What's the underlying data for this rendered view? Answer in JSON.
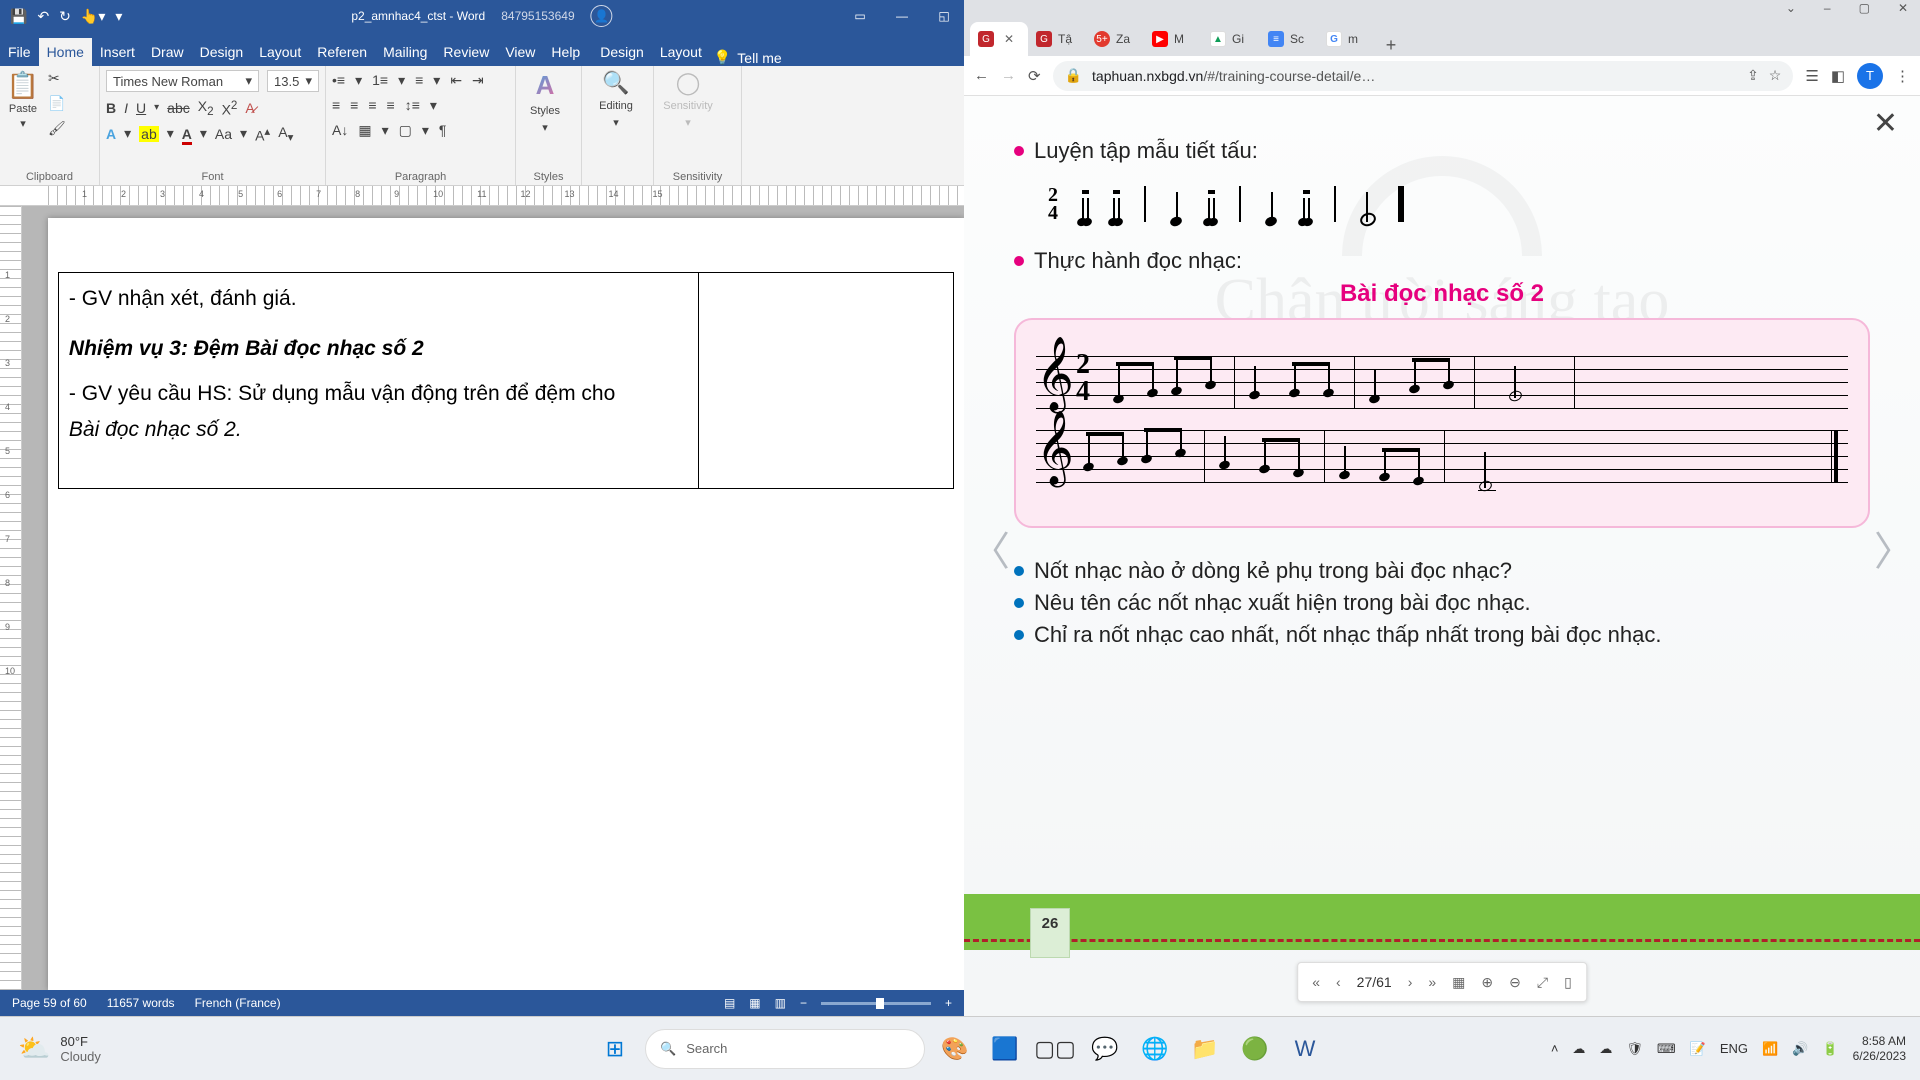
{
  "word": {
    "title_doc": "p2_amnhac4_ctst - Word",
    "title_user": "84795153649",
    "qat_icons": [
      "save-icon",
      "undo-icon",
      "redo-icon",
      "touch-icon",
      "dropdown-icon"
    ],
    "tabs": [
      "File",
      "Home",
      "Insert",
      "Draw",
      "Design",
      "Layout",
      "Referen",
      "Mailing",
      "Review",
      "View",
      "Help",
      "Design",
      "Layout"
    ],
    "active_tab": "Home",
    "tell_me": "Tell me",
    "ribbon": {
      "clipboard_label": "Clipboard",
      "paste_label": "Paste",
      "font_label": "Font",
      "font_name": "Times New Roman",
      "font_size": "13.5",
      "paragraph_label": "Paragraph",
      "styles_label": "Styles",
      "styles_big": "Styles",
      "editing_label": "Editing",
      "sensitivity_label": "Sensitivity"
    },
    "ruler_h": [
      " ",
      "1",
      "2",
      "3",
      "4",
      "5",
      "6",
      "7",
      "8",
      "9",
      "10",
      "11",
      "12",
      "13",
      "14",
      "15"
    ],
    "ruler_v": [
      "",
      "1",
      "2",
      "3",
      "4",
      "5",
      "6",
      "7",
      "8",
      "9",
      "10"
    ],
    "doc": {
      "line1": "- GV nhận xét, đánh giá.",
      "task_title": "Nhiệm vụ 3: Đệm Bài đọc nhạc số 2",
      "line2": "- GV yêu cầu HS: Sử dụng mẫu vận động trên để đệm cho",
      "line3": "Bài đọc nhạc số 2."
    },
    "status": {
      "page": "Page 59 of 60",
      "words": "11657 words",
      "lang": "French (France)"
    }
  },
  "chrome": {
    "win_controls": [
      "–",
      "▢",
      "✕"
    ],
    "tabs": [
      {
        "fav_bg": "#c1272d",
        "fav_txt": "G",
        "label": "",
        "active": true
      },
      {
        "fav_bg": "#c1272d",
        "fav_txt": "G",
        "label": "Tậ"
      },
      {
        "fav_bg": "#e23a2e",
        "fav_txt": "5+",
        "label": "Za",
        "fav_round": true
      },
      {
        "fav_bg": "#ff0000",
        "fav_txt": "▶",
        "label": "M"
      },
      {
        "fav_bg": "#ffffff",
        "fav_txt": "◈",
        "label": "Gi",
        "fc": "#0f9d58"
      },
      {
        "fav_bg": "#4285f4",
        "fav_txt": "≡",
        "label": "Sc"
      },
      {
        "fav_bg": "#ffffff",
        "fav_txt": "G",
        "label": "m",
        "fc": "#4285f4"
      }
    ],
    "addr": {
      "host": "taphuan.nxbgd.vn",
      "path": "/#/training-course-detail/e…"
    },
    "content": {
      "h1": "Luyện tập mẫu tiết tấu:",
      "h2": "Thực hành đọc nhạc:",
      "score_title": "Bài đọc nhạc số 2",
      "watermark_text": "Chân trời sáng tạo",
      "q1": "Nốt nhạc nào ở dòng kẻ phụ trong bài đọc nhạc?",
      "q2": "Nêu tên các nốt nhạc xuất hiện trong bài đọc nhạc.",
      "q3": "Chỉ ra nốt nhạc cao nhất, nốt nhạc thấp nhất trong bài đọc nhạc.",
      "page_no": "26",
      "pdf_page": "27/61"
    }
  },
  "taskbar": {
    "temp": "80°F",
    "cond": "Cloudy",
    "search_placeholder": "Search",
    "lang": "ENG",
    "time": "8:58 AM",
    "date": "6/26/2023"
  }
}
